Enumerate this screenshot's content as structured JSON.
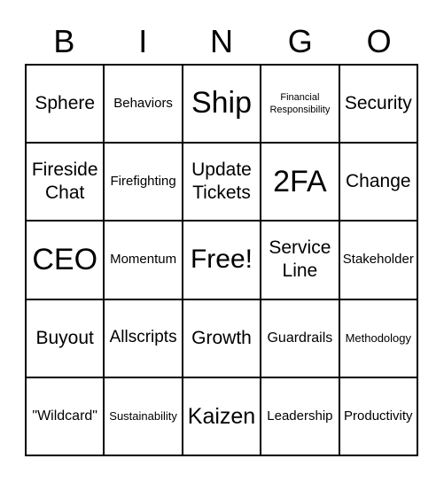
{
  "header": {
    "letters": [
      "B",
      "I",
      "N",
      "G",
      "O"
    ]
  },
  "cells": [
    "Sphere",
    "Behaviors",
    "Ship",
    "Financial Responsibility",
    "Security",
    "Fireside Chat",
    "Firefighting",
    "Update Tickets",
    "2FA",
    "Change",
    "CEO",
    "Momentum",
    "Free!",
    "Service Line",
    "Stakeholder",
    "Buyout",
    "Allscripts",
    "Growth",
    "Guardrails",
    "Methodology",
    "\"Wildcard\"",
    "Sustainability",
    "Kaizen",
    "Leadership",
    "Productivity"
  ]
}
